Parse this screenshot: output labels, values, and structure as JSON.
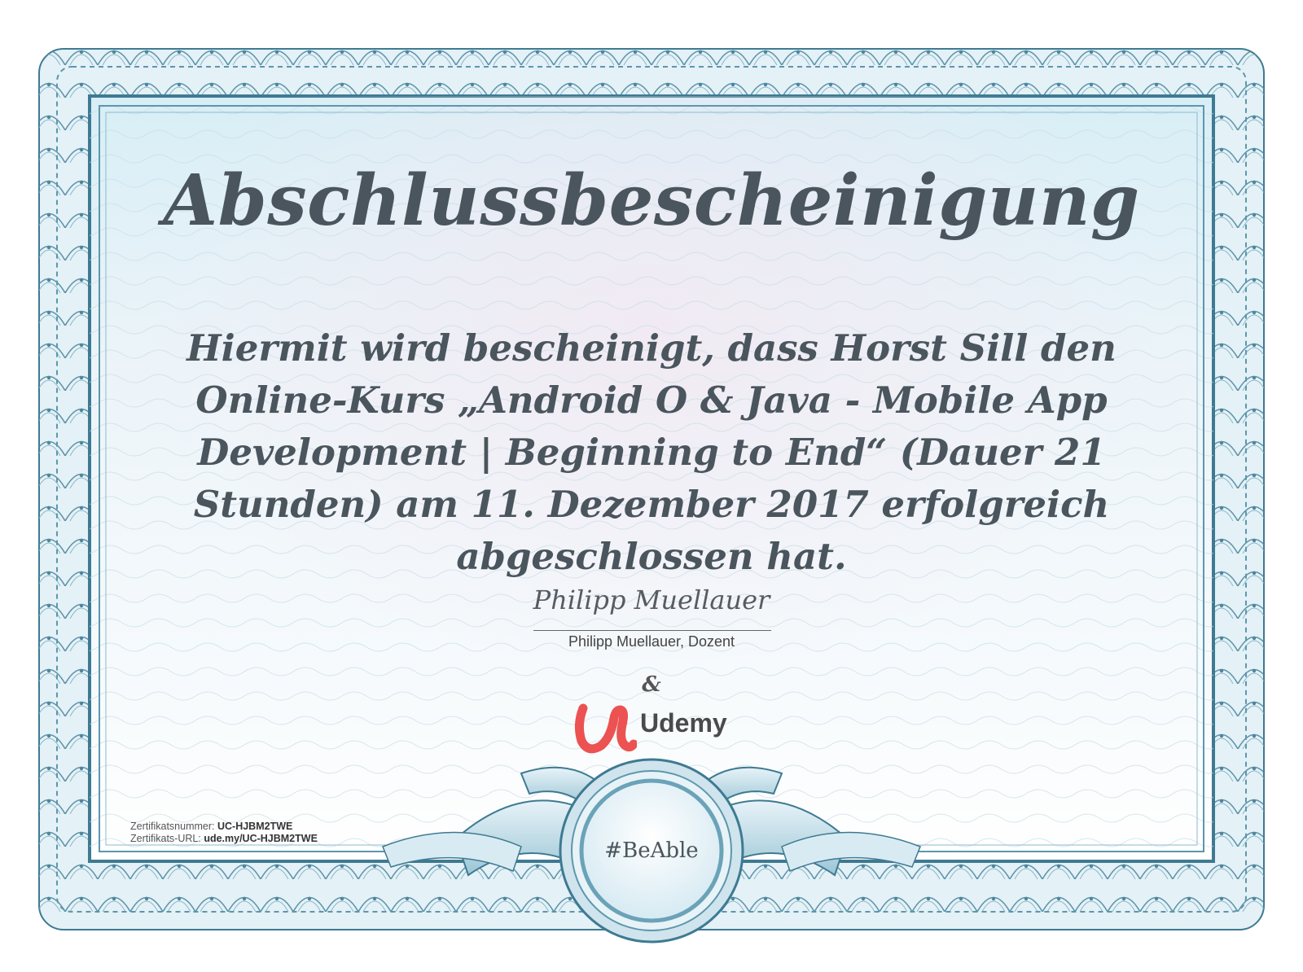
{
  "title": "Abschlussbescheinigung",
  "body": {
    "line1": "Hiermit wird bescheinigt, dass Horst Sill den",
    "line2": "Online-Kurs „Android O & Java - Mobile App",
    "line3": "Development | Beginning to End“ (Dauer 21",
    "line4": "Stunden) am 11. Dezember 2017 erfolgreich",
    "line5": "abgeschlossen hat."
  },
  "signature": "Philipp Muellauer",
  "instructor": "Philipp Muellauer, Dozent",
  "ampersand": "&",
  "brand": "Udemy",
  "certificate": {
    "number_label": "Zertifikatsnummer:",
    "number": "UC-HJBM2TWE",
    "url_label": "Zertifikats-URL:",
    "url": "ude.my/UC-HJBM2TWE"
  },
  "seal": "#BeAble",
  "colors": {
    "text": "#4a555d",
    "border": "#3e7a92",
    "udemy_red": "#ec5252"
  }
}
